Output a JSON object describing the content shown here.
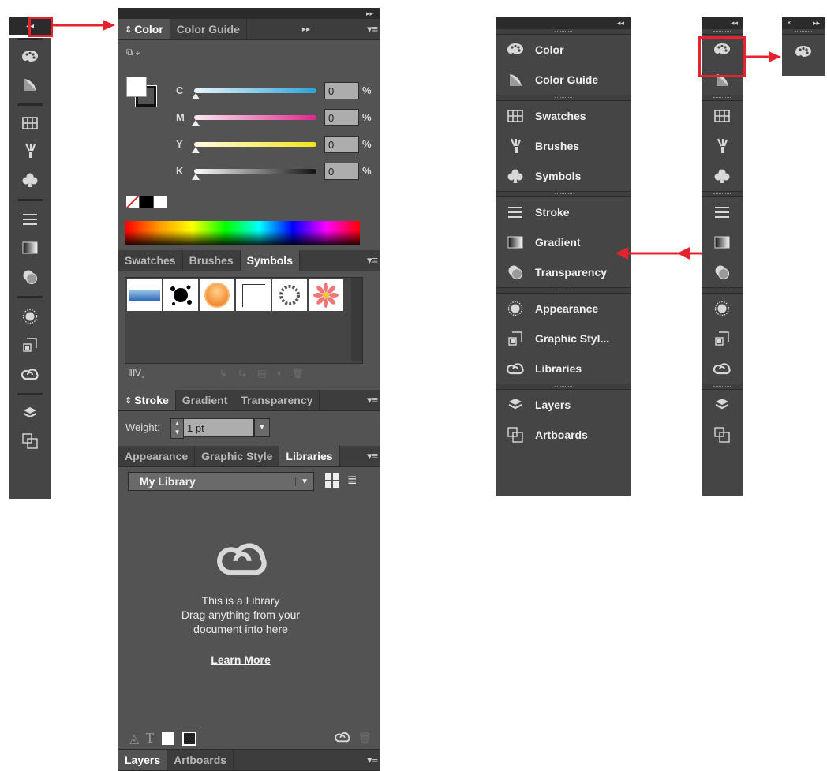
{
  "color_panel": {
    "tabs": [
      "Color",
      "Color Guide"
    ],
    "channels": [
      {
        "label": "C",
        "value": "0",
        "unit": "%",
        "gradient": [
          "#e8f6fb",
          "#29a3d9"
        ]
      },
      {
        "label": "M",
        "value": "0",
        "unit": "%",
        "gradient": [
          "#fbe8f2",
          "#e0278b"
        ]
      },
      {
        "label": "Y",
        "value": "0",
        "unit": "%",
        "gradient": [
          "#fffbe3",
          "#f3e51a"
        ]
      },
      {
        "label": "K",
        "value": "0",
        "unit": "%",
        "gradient": [
          "#ffffff",
          "#111111"
        ]
      }
    ]
  },
  "swatch_panel": {
    "tabs": [
      "Swatches",
      "Brushes",
      "Symbols"
    ]
  },
  "stroke_panel": {
    "tabs": [
      "Stroke",
      "Gradient",
      "Transparency"
    ],
    "weight_label": "Weight:",
    "weight_value": "1 pt"
  },
  "library_panel": {
    "tabs": [
      "Appearance",
      "Graphic Style",
      "Libraries"
    ],
    "library_select": "My Library",
    "message_line1": "This is a Library",
    "message_line2": "Drag anything from your",
    "message_line3": "document into here",
    "learn_more": "Learn More"
  },
  "layers_panel": {
    "tabs": [
      "Layers",
      "Artboards"
    ]
  },
  "dock_items": {
    "color": "Color",
    "color_guide": "Color Guide",
    "swatches": "Swatches",
    "brushes": "Brushes",
    "symbols": "Symbols",
    "stroke": "Stroke",
    "gradient": "Gradient",
    "transparency": "Transparency",
    "appearance": "Appearance",
    "graphic_styles": "Graphic Styl...",
    "libraries": "Libraries",
    "layers": "Layers",
    "artboards": "Artboards"
  },
  "colors": {
    "annotation": "#e5232e",
    "panel_bg": "#535353",
    "dock_bg": "#454545"
  }
}
